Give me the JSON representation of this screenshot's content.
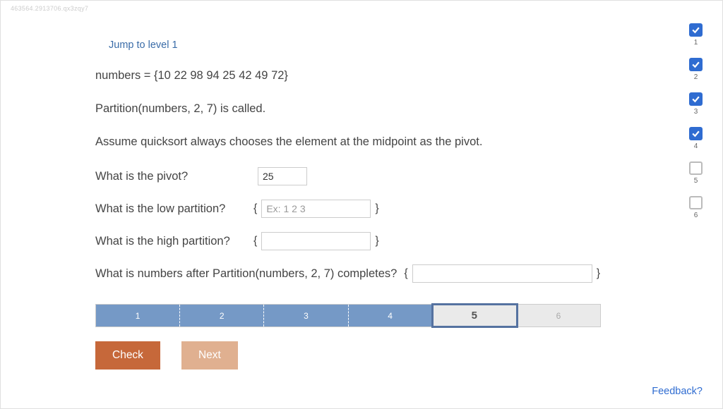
{
  "watermark": "463564.2913706.qx3zqy7",
  "jump_link": "Jump to level 1",
  "statements": {
    "s1": "numbers = {10 22 98 94 25 42 49 72}",
    "s2": "Partition(numbers, 2, 7) is called.",
    "s3": "Assume quicksort always chooses the element at the midpoint as the pivot."
  },
  "questions": {
    "pivot": {
      "label": "What is the pivot?",
      "value": "25"
    },
    "low": {
      "label": "What is the low partition?",
      "placeholder": "Ex: 1 2 3",
      "value": ""
    },
    "high": {
      "label": "What is the high partition?",
      "value": ""
    },
    "after": {
      "label": "What is numbers after Partition(numbers, 2, 7) completes?",
      "value": ""
    }
  },
  "progress": {
    "segments": [
      "1",
      "2",
      "3",
      "4",
      "5",
      "6"
    ],
    "current_index": 4
  },
  "buttons": {
    "check": "Check",
    "next": "Next"
  },
  "side_steps": [
    {
      "num": "1",
      "done": true
    },
    {
      "num": "2",
      "done": true
    },
    {
      "num": "3",
      "done": true
    },
    {
      "num": "4",
      "done": true
    },
    {
      "num": "5",
      "done": false
    },
    {
      "num": "6",
      "done": false
    }
  ],
  "feedback": "Feedback?"
}
